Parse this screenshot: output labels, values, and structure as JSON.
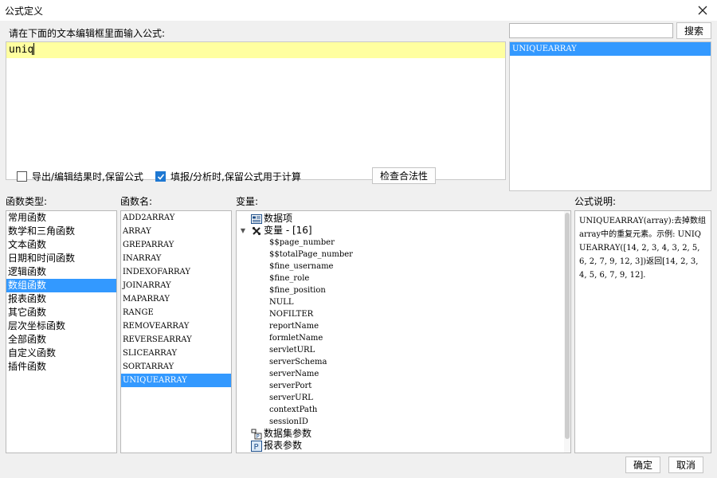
{
  "window": {
    "title": "公式定义"
  },
  "editor": {
    "prompt": "请在下面的文本编辑框里面输入公式:",
    "value": "uniq"
  },
  "search": {
    "placeholder": "",
    "button": "搜索"
  },
  "search_results": [
    "UNIQUEARRAY"
  ],
  "options": {
    "export_keep": {
      "label": "导出/编辑结果时,保留公式",
      "checked": false
    },
    "fill_keep": {
      "label": "填报/分析时,保留公式用于计算",
      "checked": true
    }
  },
  "check_button": "检查合法性",
  "categories": {
    "label": "函数类型:",
    "items": [
      "常用函数",
      "数学和三角函数",
      "文本函数",
      "日期和时间函数",
      "逻辑函数",
      "数组函数",
      "报表函数",
      "其它函数",
      "层次坐标函数",
      "全部函数",
      "自定义函数",
      "插件函数"
    ],
    "selected": "数组函数"
  },
  "functions": {
    "label": "函数名:",
    "items": [
      "ADD2ARRAY",
      "ARRAY",
      "GREPARRAY",
      "INARRAY",
      "INDEXOFARRAY",
      "JOINARRAY",
      "MAPARRAY",
      "RANGE",
      "REMOVEARRAY",
      "REVERSEARRAY",
      "SLICEARRAY",
      "SORTARRAY",
      "UNIQUEARRAY"
    ],
    "selected": "UNIQUEARRAY"
  },
  "variables": {
    "label": "变量:",
    "data_items": "数据项",
    "var_group": "变量 - [16]",
    "vars": [
      "$$page_number",
      "$$totalPage_number",
      "$fine_username",
      "$fine_role",
      "$fine_position",
      "NULL",
      "NOFILTER",
      "reportName",
      "formletName",
      "servletURL",
      "serverSchema",
      "serverName",
      "serverPort",
      "serverURL",
      "contextPath",
      "sessionID"
    ],
    "dataset_params": "数据集参数",
    "report_params": "报表参数"
  },
  "description": {
    "label": "公式说明:",
    "text": "UNIQUEARRAY(array):去掉数组array中的重复元素。示例: UNIQUEARRAY([14, 2, 3, 4, 3, 2, 5, 6, 2, 7, 9, 12, 3])返回[14, 2, 3, 4, 5, 6, 7, 9, 12]."
  },
  "footer": {
    "ok": "确定",
    "cancel": "取消"
  },
  "colors": {
    "selection": "#3399ff",
    "editor_line": "#ffffa0",
    "checkbox_checked": "#1e78d2"
  }
}
